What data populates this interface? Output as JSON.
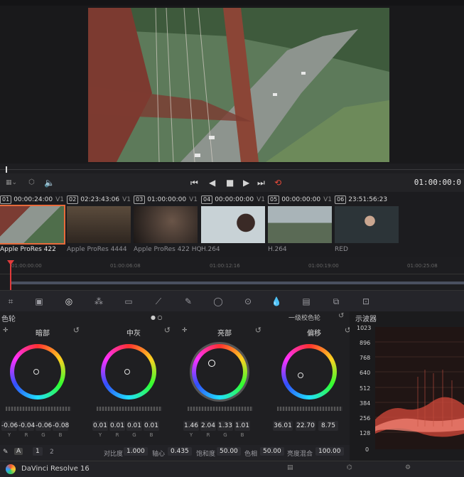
{
  "viewer": {
    "timecode": "01:00:00:0"
  },
  "clips": [
    {
      "num": "01",
      "tc": "00:00:24:00",
      "track": "V1",
      "codec": "Apple ProRes 422",
      "selected": true
    },
    {
      "num": "02",
      "tc": "02:23:43:06",
      "track": "V1",
      "codec": "Apple ProRes 4444"
    },
    {
      "num": "03",
      "tc": "01:00:00:00",
      "track": "V1",
      "codec": "Apple ProRes 422 HQ"
    },
    {
      "num": "04",
      "tc": "00:00:00:00",
      "track": "V1",
      "codec": "H.264"
    },
    {
      "num": "05",
      "tc": "00:00:00:00",
      "track": "V1",
      "codec": "H.264"
    },
    {
      "num": "06",
      "tc": "23:51:56:23",
      "track": "",
      "codec": "RED"
    }
  ],
  "ruler": {
    "labels": [
      "01:00:00:00",
      "01:00:06:08",
      "01:00:12:16",
      "01:00:19:00",
      "01:00:25:08"
    ]
  },
  "wheels_panel": {
    "title": "色轮",
    "mode": "一级校色轮",
    "wheels": [
      {
        "label": "暗部",
        "values": [
          "-0.06",
          "-0.04",
          "-0.06",
          "-0.08"
        ]
      },
      {
        "label": "中灰",
        "values": [
          "0.01",
          "0.01",
          "0.01",
          "0.01"
        ]
      },
      {
        "label": "亮部",
        "values": [
          "1.46",
          "2.04",
          "1.33",
          "1.01"
        ]
      },
      {
        "label": "偏移",
        "values": [
          "36.01",
          "22.70",
          "8.75",
          ""
        ]
      }
    ],
    "channels": [
      "Y",
      "R",
      "G",
      "B"
    ]
  },
  "bottom_controls": {
    "page1": "1",
    "page2": "2",
    "contrast_label": "对比度",
    "contrast": "1.000",
    "pivot_label": "轴心",
    "pivot": "0.435",
    "saturation_label": "饱和度",
    "saturation": "50.00",
    "hue_label": "色相",
    "hue": "50.00",
    "lum_mix_label": "亮度混合",
    "lum_mix": "100.00"
  },
  "scope": {
    "title": "示波器",
    "scale": [
      "1023",
      "896",
      "768",
      "640",
      "512",
      "384",
      "256",
      "128",
      "0"
    ]
  },
  "status": {
    "app": "DaVinci Resolve 16"
  }
}
